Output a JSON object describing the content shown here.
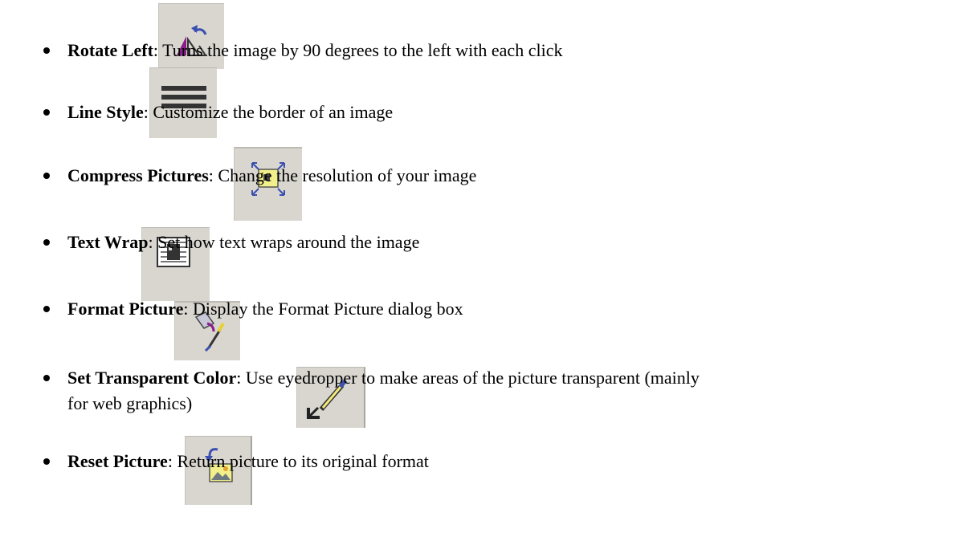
{
  "items": [
    {
      "name": "Rotate Left",
      "separator": ": ",
      "desc": "Turns the image by 90 degrees to the left with each click",
      "icon": "rotate-left-icon"
    },
    {
      "name": "Line Style",
      "separator": ": ",
      "desc": "Customize the border of an image",
      "icon": "line-style-icon"
    },
    {
      "name": "Compress Pictures",
      "separator": ": ",
      "desc": "Change the resolution of your image",
      "icon": "compress-pictures-icon"
    },
    {
      "name": "Text Wrap",
      "separator": ": ",
      "desc": "Set how text wraps around the image",
      "icon": "text-wrap-icon"
    },
    {
      "name": "Format Picture",
      "separator": ": ",
      "desc": "Display the Format Picture dialog box",
      "icon": "format-picture-icon"
    },
    {
      "name": "Set Transparent Color",
      "separator": ": ",
      "desc": "Use eyedropper to make areas of the picture transparent (mainly",
      "desc_cont": "for web graphics)",
      "icon": "set-transparent-color-icon"
    },
    {
      "name": "Reset Picture",
      "separator": ": ",
      "desc": "Return picture to its original format",
      "icon": "reset-picture-icon"
    }
  ]
}
